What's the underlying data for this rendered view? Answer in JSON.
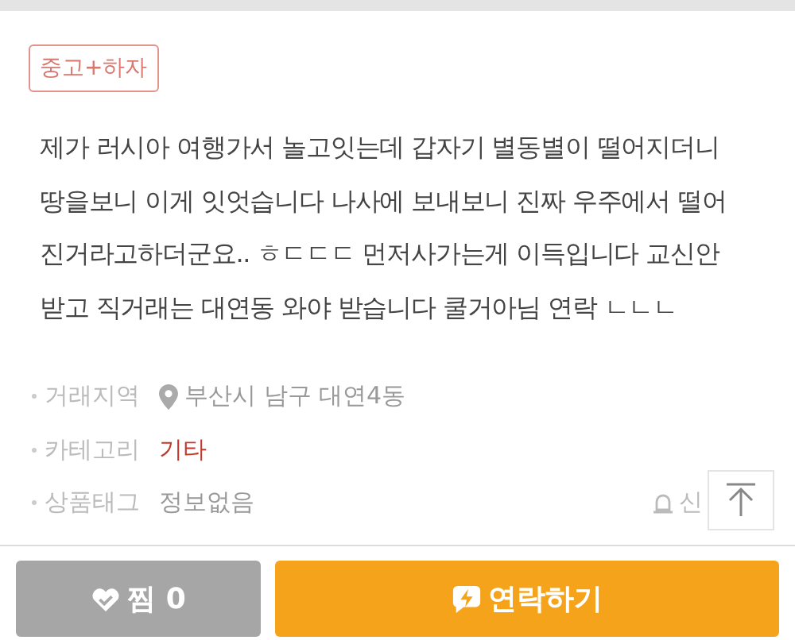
{
  "tag": "중고+하자",
  "description_lines": [
    "제가 러시아 여행가서 놀고잇는데 갑자기 별동별이 떨어지더니",
    "땅을보니 이게 잇엇습니다 나사에 보내보니 진짜 우주에서 떨어",
    "진거라고하더군요.. ㅎㄷㄷㄷ 먼저사가는게 이득입니다  교신안",
    "받고 직거래는 대연동 와야 받습니다 쿨거아님 연락 ㄴㄴㄴ"
  ],
  "info": [
    {
      "kind": "location",
      "label": "거래지역",
      "value": "부산시 남구 대연4동"
    },
    {
      "kind": "category",
      "label": "카테고리",
      "value": "기타"
    },
    {
      "kind": "tags",
      "label": "상품태그",
      "value": "정보없음"
    }
  ],
  "report": "신",
  "like_button": {
    "label": "찜 0"
  },
  "contact_button": {
    "label": "연락하기"
  }
}
